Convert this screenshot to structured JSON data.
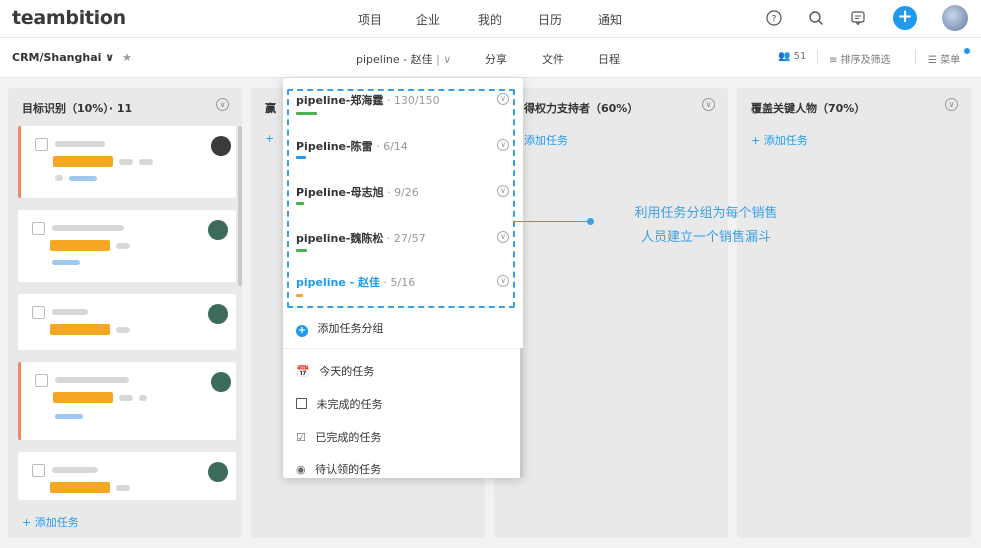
{
  "app": {
    "logo": "teambition"
  },
  "topnav": [
    "项目",
    "企业",
    "我的",
    "日历",
    "通知"
  ],
  "subbar": {
    "project": "CRM/Shanghai ∨",
    "star": "★",
    "pipeline": "pipeline - 赵佳",
    "pipeline_sep": "| ∨",
    "tabs": [
      "分享",
      "文件",
      "日程"
    ],
    "members": "51",
    "sort": "排序及筛选",
    "menu": "菜单"
  },
  "columns": [
    {
      "title": "目标识别（10%）· 11",
      "add": "+ 添加任务"
    },
    {
      "title": "赢",
      "add": "+"
    },
    {
      "title": "得权力支持者（60%）",
      "add": "添加任务"
    },
    {
      "title": "覆盖关键人物（70%）",
      "add": "+ 添加任务"
    }
  ],
  "dropdown": {
    "pipelines": [
      {
        "name": "pipeline-郑海霆",
        "count": " · 130/150",
        "progress": 0.87,
        "color": "#4caf50"
      },
      {
        "name": "Pipeline-陈雷",
        "count": " · 6/14",
        "progress": 0.43,
        "color": "#1e9bf0"
      },
      {
        "name": "Pipeline-母志旭",
        "count": " · 9/26",
        "progress": 0.35,
        "color": "#4caf50"
      },
      {
        "name": "pipeline-魏陈松",
        "count": " · 27/57",
        "progress": 0.47,
        "color": "#4caf50"
      },
      {
        "name": "pipeline - 赵佳",
        "count": " · 5/16",
        "progress": 0.31,
        "color": "#f5a623",
        "active": true
      }
    ],
    "add_group": "添加任务分组",
    "filters": [
      {
        "icon": "calendar-icon",
        "label": "今天的任务"
      },
      {
        "icon": "square-icon",
        "label": "未完成的任务"
      },
      {
        "icon": "checked-square-icon",
        "label": "已完成的任务"
      },
      {
        "icon": "person-circle-icon",
        "label": "待认领的任务"
      }
    ]
  },
  "callout": {
    "line1": "利用任务分组为每个销售",
    "line2": "人员建立一个销售漏斗"
  },
  "colors": {
    "accent": "#1e9bf0",
    "callout": "#3aa0e8",
    "orange": "#f5a623",
    "red_border": "#f08a5d"
  }
}
